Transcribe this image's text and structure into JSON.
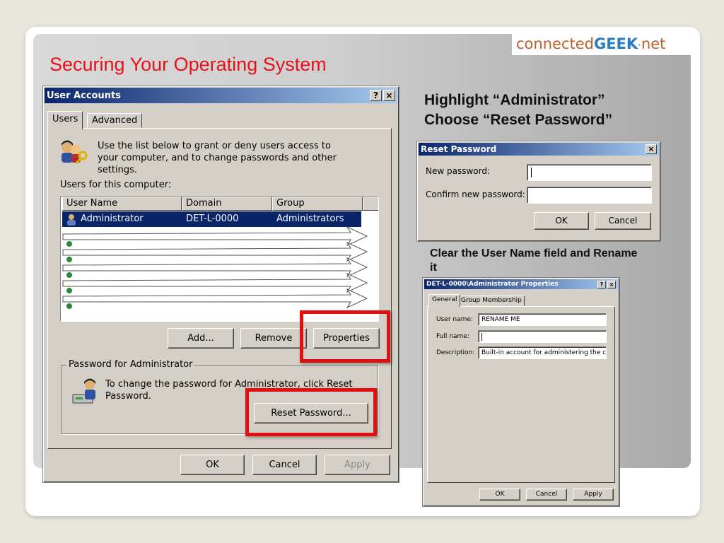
{
  "slide": {
    "title": "Securing Your Operating System",
    "logo": {
      "part1": "connected",
      "part2": "GEEK",
      "part3": "·",
      "part4": "net"
    },
    "instruction_line1": "Highlight “Administrator”",
    "instruction_line2": "Choose “Reset Password”",
    "instruction_rename": "Clear the User Name field and Rename it",
    "colors": {
      "title": "#e8101a",
      "highlight": "#e01010",
      "titlebar": "#0a246a"
    }
  },
  "user_accounts": {
    "title": "User Accounts",
    "help_btn": "?",
    "close_btn": "×",
    "tabs": [
      {
        "label": "Users"
      },
      {
        "label": "Advanced"
      }
    ],
    "intro_text": "Use the list below to grant or deny users access to your computer, and to change passwords and other settings.",
    "list_label": "Users for this computer:",
    "columns": [
      "User Name",
      "Domain",
      "Group"
    ],
    "rows": [
      {
        "user": "Administrator",
        "domain": "DET-L-0000",
        "group": "Administrators",
        "selected": true
      }
    ],
    "buttons": {
      "add": "Add...",
      "remove": "Remove",
      "properties": "Properties"
    },
    "password_group_title": "Password for Administrator",
    "password_text": "To change the password for Administrator, click Reset Password.",
    "reset_password_btn": "Reset Password...",
    "ok": "OK",
    "cancel": "Cancel",
    "apply": "Apply"
  },
  "reset_password": {
    "title": "Reset Password",
    "close_btn": "×",
    "new_label": "New password:",
    "confirm_label": "Confirm new password:",
    "new_value": "",
    "confirm_value": "",
    "ok": "OK",
    "cancel": "Cancel"
  },
  "properties": {
    "title": "DET-L-0000\\Administrator Properties",
    "help_btn": "?",
    "close_btn": "×",
    "tabs": [
      {
        "label": "General"
      },
      {
        "label": "Group Membership"
      }
    ],
    "user_name_label": "User name:",
    "user_name_value": "RENAME ME",
    "full_name_label": "Full name:",
    "full_name_value": "",
    "description_label": "Description:",
    "description_value": "Built-in account for administering the comput",
    "ok": "OK",
    "cancel": "Cancel",
    "apply": "Apply"
  }
}
